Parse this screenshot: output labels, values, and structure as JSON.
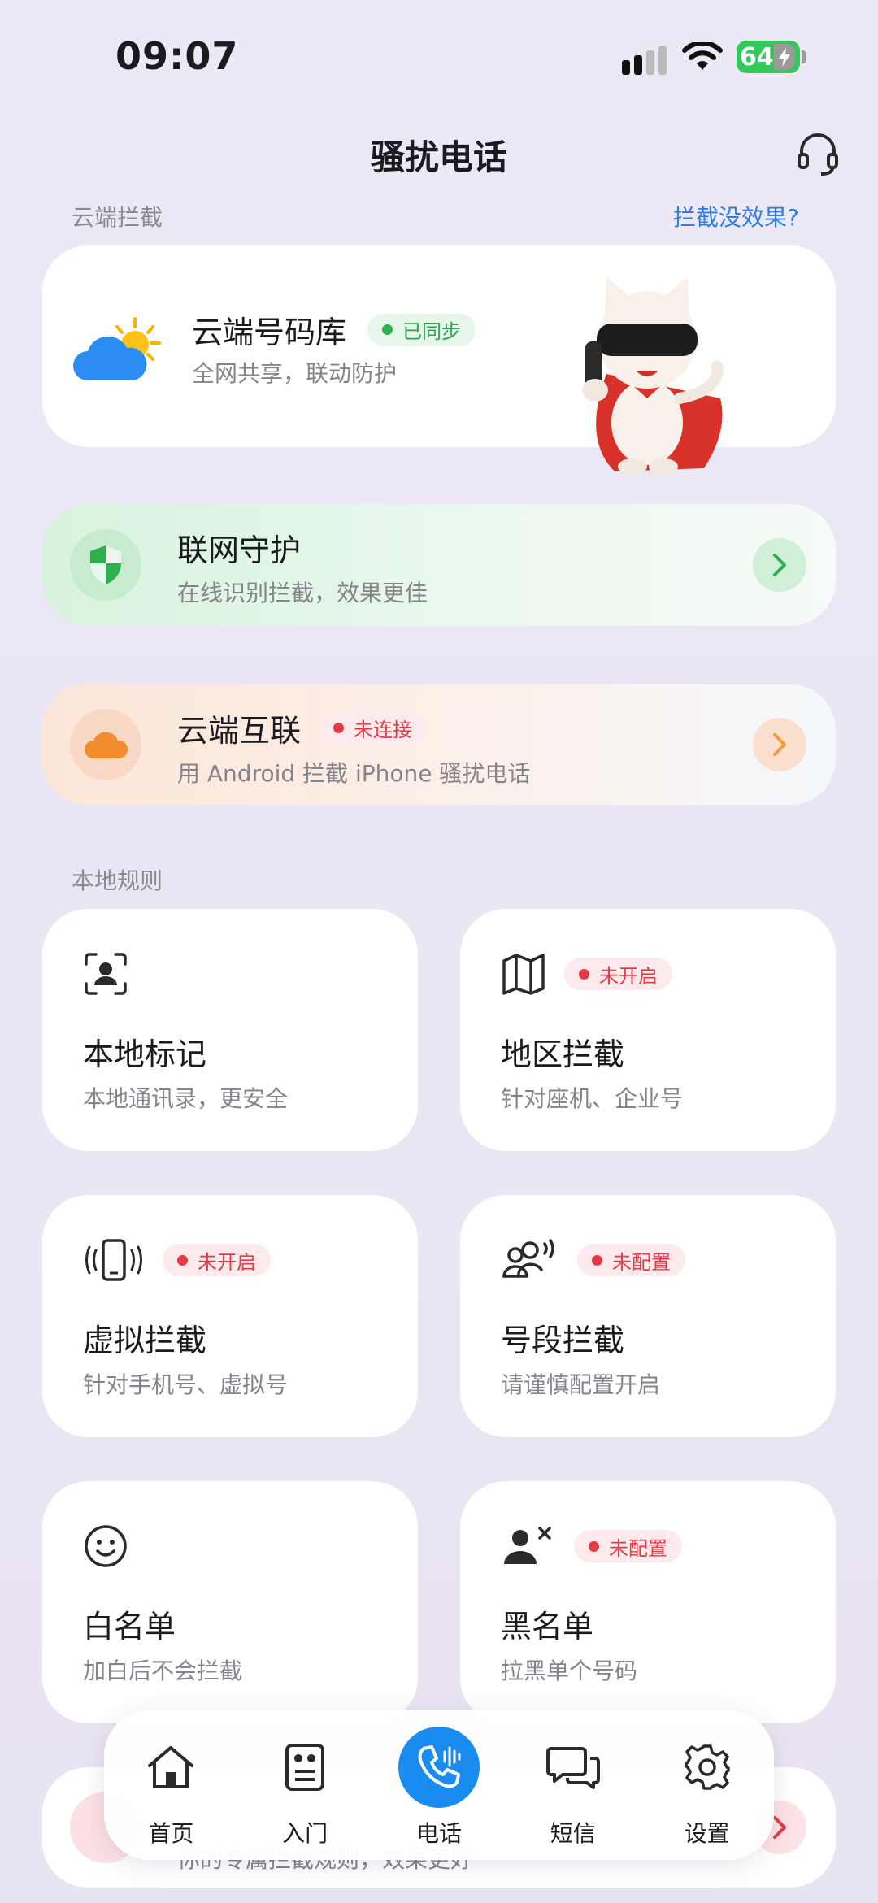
{
  "status_bar": {
    "time": "09:07",
    "battery": "64"
  },
  "header": {
    "title": "骚扰电话",
    "icons": {
      "support": "headset-icon"
    }
  },
  "cloud_section": {
    "label": "云端拦截",
    "help_link": "拦截没效果?",
    "cloud_db": {
      "title": "云端号码库",
      "badge": "已同步",
      "subtitle": "全网共享，联动防护",
      "icon": "weather-cloud-sun-icon"
    }
  },
  "network_guard": {
    "title": "联网守护",
    "subtitle": "在线识别拦截，效果更佳",
    "icon": "shield-icon"
  },
  "cloud_link": {
    "title": "云端互联",
    "badge": "未连接",
    "subtitle": "用 Android 拦截 iPhone 骚扰电话",
    "icon": "cloud-icon"
  },
  "local_section": {
    "label": "本地规则",
    "cards": [
      {
        "title": "本地标记",
        "subtitle": "本地通讯录，更安全",
        "badge": "",
        "icon": "contact-scan-icon"
      },
      {
        "title": "地区拦截",
        "subtitle": "针对座机、企业号",
        "badge": "未开启",
        "icon": "map-icon"
      },
      {
        "title": "虚拟拦截",
        "subtitle": "针对手机号、虚拟号",
        "badge": "未开启",
        "icon": "vibrating-phone-icon"
      },
      {
        "title": "号段拦截",
        "subtitle": "请谨慎配置开启",
        "badge": "未配置",
        "icon": "people-sound-icon"
      },
      {
        "title": "白名单",
        "subtitle": "加白后不会拦截",
        "badge": "",
        "icon": "smiley-icon"
      },
      {
        "title": "黑名单",
        "subtitle": "拉黑单个号码",
        "badge": "未配置",
        "icon": "user-block-icon"
      }
    ]
  },
  "partial_card": {
    "subtitle": "你的专属拦截规则，效果更好"
  },
  "bottom_nav": {
    "items": [
      {
        "label": "首页",
        "icon": "home-icon"
      },
      {
        "label": "入门",
        "icon": "guide-icon"
      },
      {
        "label": "电话",
        "icon": "phone-icon"
      },
      {
        "label": "短信",
        "icon": "message-icon"
      },
      {
        "label": "设置",
        "icon": "gear-icon"
      }
    ],
    "active": "电话"
  },
  "colors": {
    "accent": "#1a8cf0",
    "link": "#2a7de1",
    "green": "#2fb04f",
    "red": "#e53a46",
    "orange": "#f29a3c"
  }
}
